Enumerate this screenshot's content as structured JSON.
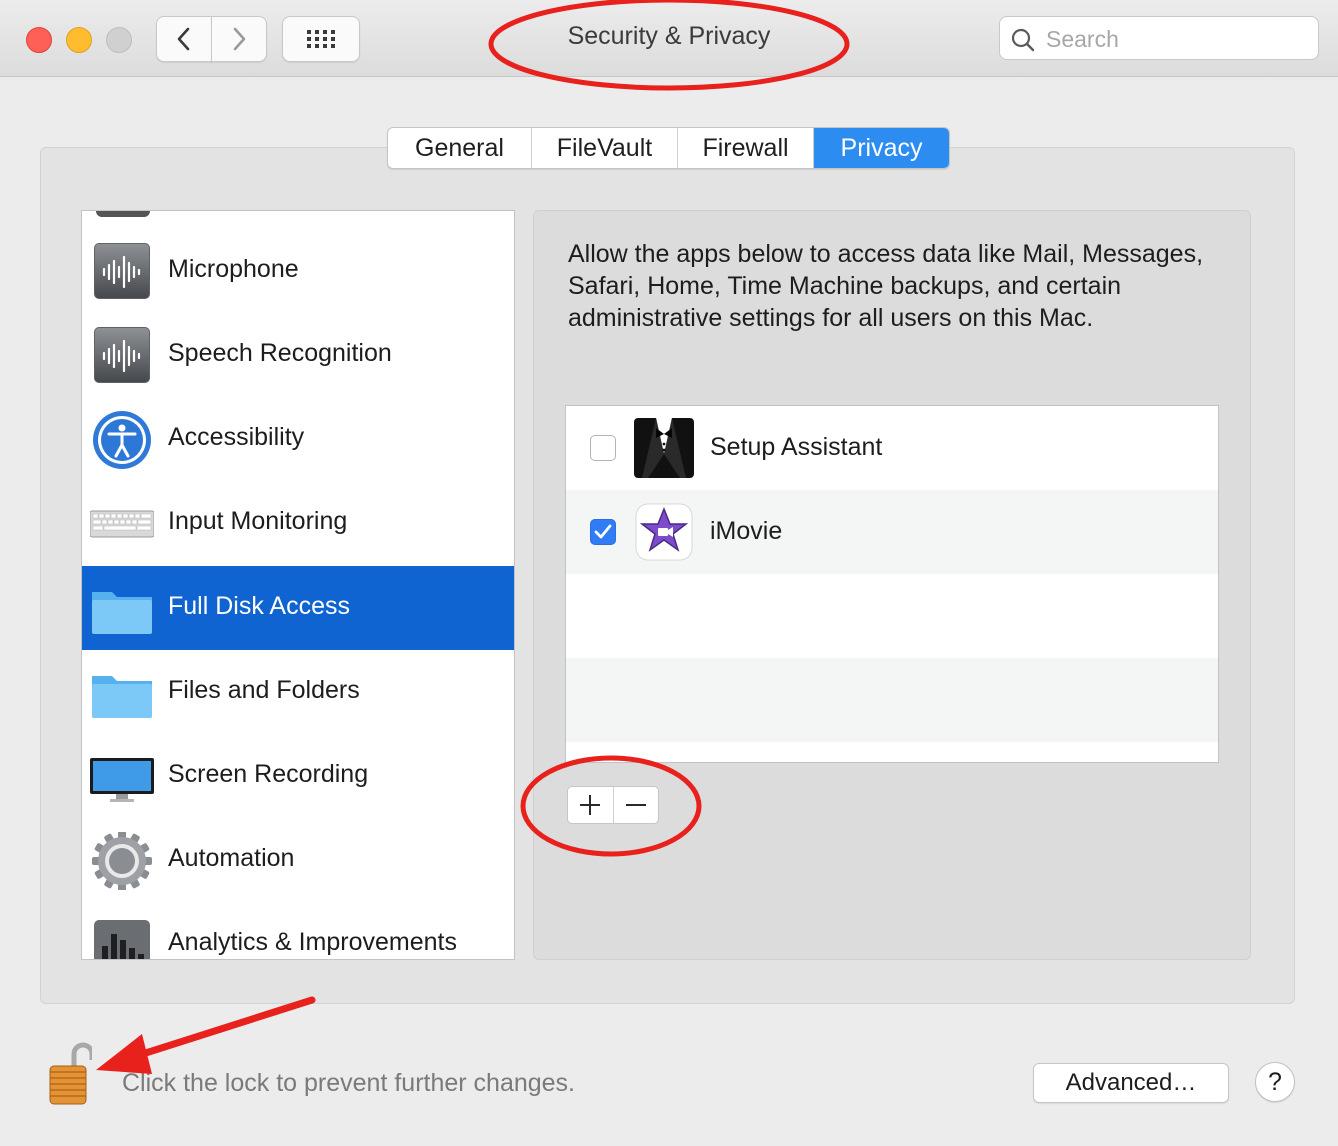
{
  "window": {
    "title": "Security & Privacy",
    "search_placeholder": "Search"
  },
  "tabs": [
    {
      "label": "General",
      "active": false
    },
    {
      "label": "FileVault",
      "active": false
    },
    {
      "label": "Firewall",
      "active": false
    },
    {
      "label": "Privacy",
      "active": true
    }
  ],
  "sidebar": {
    "items": [
      {
        "label": "Microphone",
        "icon": "microphone-waveform-icon"
      },
      {
        "label": "Speech Recognition",
        "icon": "speech-waveform-icon"
      },
      {
        "label": "Accessibility",
        "icon": "accessibility-icon"
      },
      {
        "label": "Input Monitoring",
        "icon": "keyboard-icon"
      },
      {
        "label": "Full Disk Access",
        "icon": "folder-icon",
        "selected": true
      },
      {
        "label": "Files and Folders",
        "icon": "folder-icon"
      },
      {
        "label": "Screen Recording",
        "icon": "display-icon"
      },
      {
        "label": "Automation",
        "icon": "gear-icon"
      },
      {
        "label": "Analytics & Improvements",
        "icon": "bar-chart-icon"
      }
    ]
  },
  "main": {
    "description": "Allow the apps below to access data like Mail, Messages, Safari, Home, Time Machine backups, and certain administrative settings for all users on this Mac.",
    "apps": [
      {
        "name": "Setup Assistant",
        "checked": false,
        "icon": "tuxedo-icon"
      },
      {
        "name": "iMovie",
        "checked": true,
        "icon": "imovie-star-icon"
      }
    ]
  },
  "footer": {
    "lock_message": "Click the lock to prevent further changes.",
    "advanced_label": "Advanced…",
    "help_label": "?"
  },
  "colors": {
    "accent": "#2d8cf0",
    "selection": "#0f64d2",
    "annotation": "#e8211c"
  }
}
